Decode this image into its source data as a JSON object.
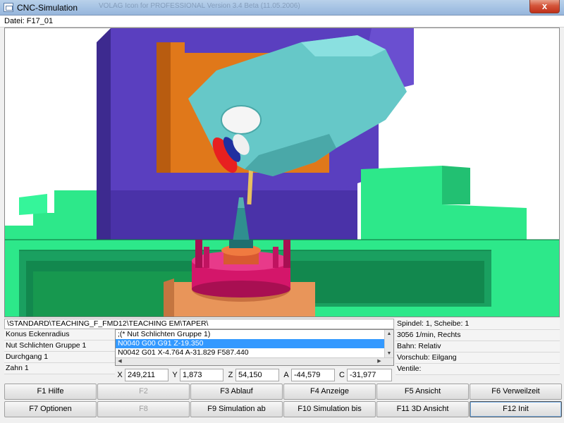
{
  "window": {
    "title": "CNC-Simulation",
    "close_label": "x",
    "background_tabs": "      VOLAG           Icon for PROFESSIONAL                    Version 3.4 Beta (11.05.2006)"
  },
  "file": {
    "label": "Datei: F17_01"
  },
  "viewport": {
    "colors": {
      "machine_frame": "#5a3fbf",
      "slide": "#e0781a",
      "table": "#2de88a",
      "spindle_head": "#66c8c8",
      "workpiece_fixture": "#d4166a",
      "tool_holder": "#2f8f8f",
      "fixture_base": "#e8955a"
    }
  },
  "program_path": "\\STANDARD\\TEACHING_F_FMD12\\TEACHING EM\\TAPER\\",
  "left_info": [
    {
      "text": "Konus Eckenradius"
    },
    {
      "text": "Nut Schlichten Gruppe 1"
    },
    {
      "text": "Durchgang 1"
    },
    {
      "text": "Zahn 1"
    }
  ],
  "nc_lines": [
    {
      "text": ";(* Nut Schlichten Gruppe 1)",
      "selected": false
    },
    {
      "text": "N0040 G00 G91 Z-19.350",
      "selected": true
    },
    {
      "text": "N0042 G01 X-4.764 A-31.829 F587.440",
      "selected": false
    }
  ],
  "right_info": [
    {
      "text": "Spindel: 1, Scheibe: 1"
    },
    {
      "text": "3056 1/min, Rechts"
    },
    {
      "text": "Bahn: Relativ"
    },
    {
      "text": "Vorschub: Eilgang"
    },
    {
      "text": "Ventile:"
    }
  ],
  "coordinates": [
    {
      "axis": "X",
      "value": "249,211"
    },
    {
      "axis": "Y",
      "value": "1,873"
    },
    {
      "axis": "Z",
      "value": "54,150"
    },
    {
      "axis": "A",
      "value": "-44,579"
    },
    {
      "axis": "C",
      "value": "-31,977"
    }
  ],
  "function_keys": [
    {
      "label": "F1 Hilfe",
      "enabled": true
    },
    {
      "label": "F2",
      "enabled": false
    },
    {
      "label": "F3 Ablauf",
      "enabled": true
    },
    {
      "label": "F4 Anzeige",
      "enabled": true
    },
    {
      "label": "F5 Ansicht",
      "enabled": true
    },
    {
      "label": "F6 Verweilzeit",
      "enabled": true
    },
    {
      "label": "F7 Optionen",
      "enabled": true
    },
    {
      "label": "F8",
      "enabled": false
    },
    {
      "label": "F9 Simulation ab",
      "enabled": true
    },
    {
      "label": "F10 Simulation bis",
      "enabled": true
    },
    {
      "label": "F11 3D Ansicht",
      "enabled": true
    },
    {
      "label": "F12 Init",
      "enabled": true
    }
  ]
}
